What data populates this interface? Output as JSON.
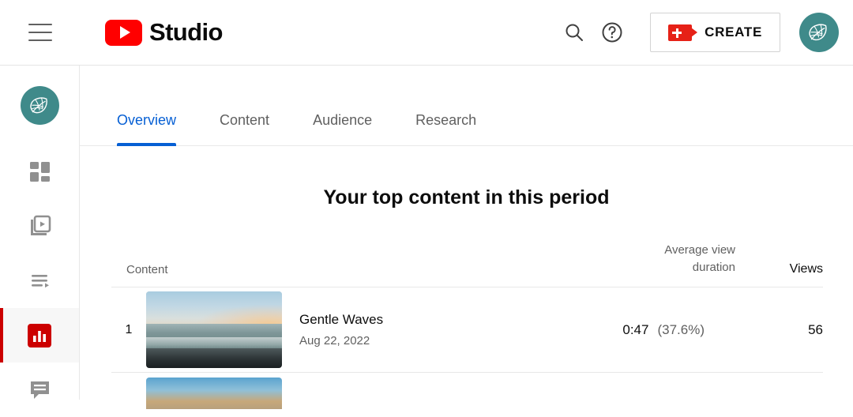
{
  "header": {
    "menu_icon": "hamburger-menu-icon",
    "logo_icon": "youtube-play-logo-icon",
    "brand": "Studio",
    "search_icon": "search-icon",
    "help_icon": "help-question-icon",
    "create_label": "CREATE",
    "create_icon": "video-camera-plus-icon",
    "avatar_icon": "channel-avatar-leaf-icon"
  },
  "sidebar": {
    "avatar_icon": "channel-avatar-leaf-icon",
    "items": [
      {
        "name": "dashboard",
        "icon": "dashboard-grid-icon",
        "active": false
      },
      {
        "name": "content",
        "icon": "video-stack-play-icon",
        "active": false
      },
      {
        "name": "playlists",
        "icon": "playlist-lines-play-icon",
        "active": false
      },
      {
        "name": "analytics",
        "icon": "analytics-bar-chart-icon",
        "active": true
      },
      {
        "name": "comments",
        "icon": "comments-speech-bubble-icon",
        "active": false
      }
    ]
  },
  "main": {
    "tabs": [
      {
        "label": "Overview",
        "active": true
      },
      {
        "label": "Content",
        "active": false
      },
      {
        "label": "Audience",
        "active": false
      },
      {
        "label": "Research",
        "active": false
      }
    ],
    "panel_title": "Your top content in this period",
    "table": {
      "headers": {
        "content": "Content",
        "avg_view_duration_line1": "Average view",
        "avg_view_duration_line2": "duration",
        "views": "Views"
      },
      "rows": [
        {
          "rank": "1",
          "thumbnail": "beach-sunset-thumbnail",
          "title": "Gentle Waves",
          "date": "Aug 22, 2022",
          "avg_view_duration": "0:47",
          "avg_view_percentage": "(37.6%)",
          "views": "56"
        }
      ]
    }
  },
  "colors": {
    "accent_blue": "#065fd4",
    "youtube_red": "#ff0000",
    "active_red": "#cc0000",
    "avatar_teal": "#3f8a8a",
    "text_primary": "#0d0d0d",
    "text_secondary": "#606060"
  }
}
